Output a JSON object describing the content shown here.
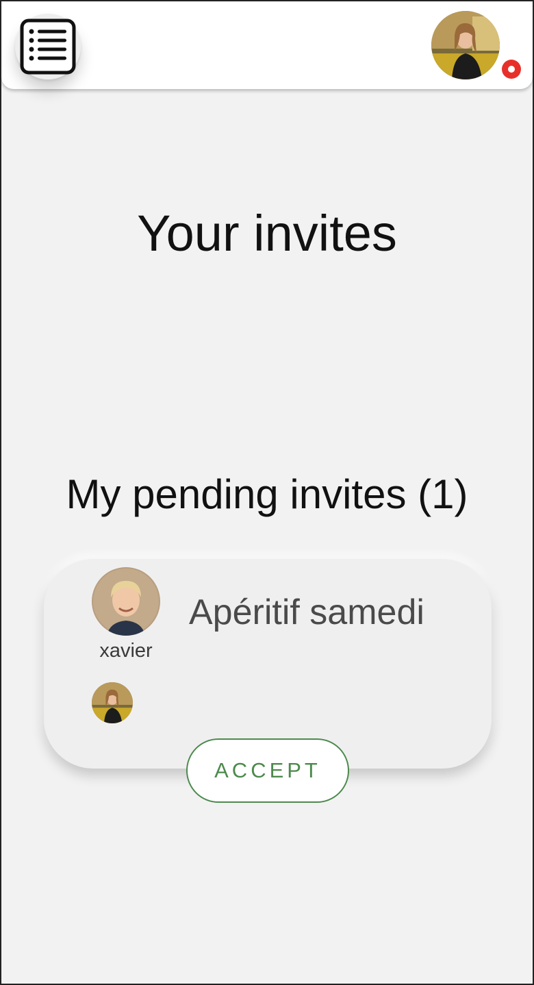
{
  "header": {
    "menu_icon": "list-menu-icon",
    "profile_avatar": "user-avatar-photo",
    "notification_color": "#e8302a"
  },
  "main": {
    "title": "Your invites",
    "pending_heading": "My pending invites (1)"
  },
  "invites": [
    {
      "host_name": "xavier",
      "event_title": "Apéritif samedi",
      "accept_label": "ACCEPT",
      "accent_color": "#4c8a4c"
    }
  ]
}
